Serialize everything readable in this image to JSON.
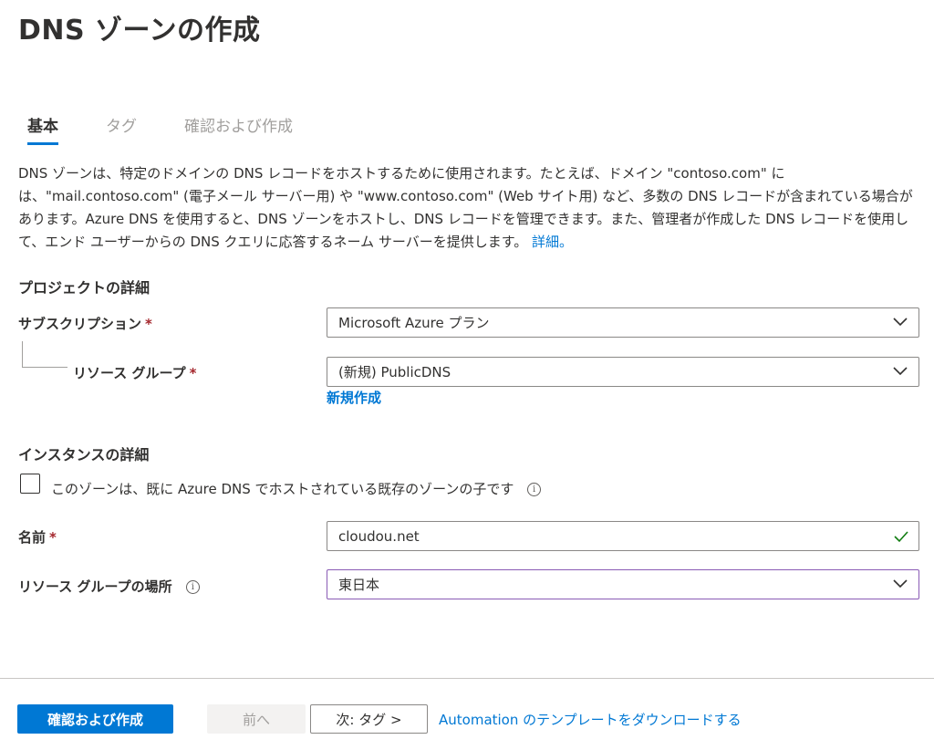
{
  "page_title": "DNS ゾーンの作成",
  "tabs": [
    {
      "label": "基本",
      "active": true
    },
    {
      "label": "タグ",
      "active": false
    },
    {
      "label": "確認および作成",
      "active": false
    }
  ],
  "description": {
    "text": "DNS ゾーンは、特定のドメインの DNS レコードをホストするために使用されます。たとえば、ドメイン \"contoso.com\" には、\"mail.contoso.com\" (電子メール サーバー用) や \"www.contoso.com\" (Web サイト用) など、多数の DNS レコードが含まれている場合があります。Azure DNS を使用すると、DNS ゾーンをホストし、DNS レコードを管理できます。また、管理者が作成した DNS レコードを使用して、エンド ユーザーからの DNS クエリに応答するネーム サーバーを提供します。",
    "link": "詳細。"
  },
  "project_details": {
    "heading": "プロジェクトの詳細",
    "subscription_label": "サブスクリプション",
    "subscription_value": "Microsoft Azure プラン",
    "resource_group_label": "リソース グループ",
    "resource_group_value": "(新規) PublicDNS",
    "create_new_link": "新規作成"
  },
  "instance_details": {
    "heading": "インスタンスの詳細",
    "child_zone_label": "このゾーンは、既に Azure DNS でホストされている既存のゾーンの子です",
    "child_zone_checked": false,
    "name_label": "名前",
    "name_value": "cloudou.net",
    "location_label": "リソース グループの場所",
    "location_value": "東日本"
  },
  "required_marker": "*",
  "info_glyph": "i",
  "footer": {
    "review_create": "確認および作成",
    "previous": "前へ",
    "next": "次: タグ >",
    "automation_link": "Automation のテンプレートをダウンロードする"
  },
  "colors": {
    "accent": "#0078d4",
    "required": "#a4262c",
    "valid": "#107c10",
    "focus_border": "#8a5bb5"
  },
  "icons": {
    "dropdown": "chevron-down-icon",
    "valid": "checkmark-icon",
    "info": "info-icon"
  }
}
